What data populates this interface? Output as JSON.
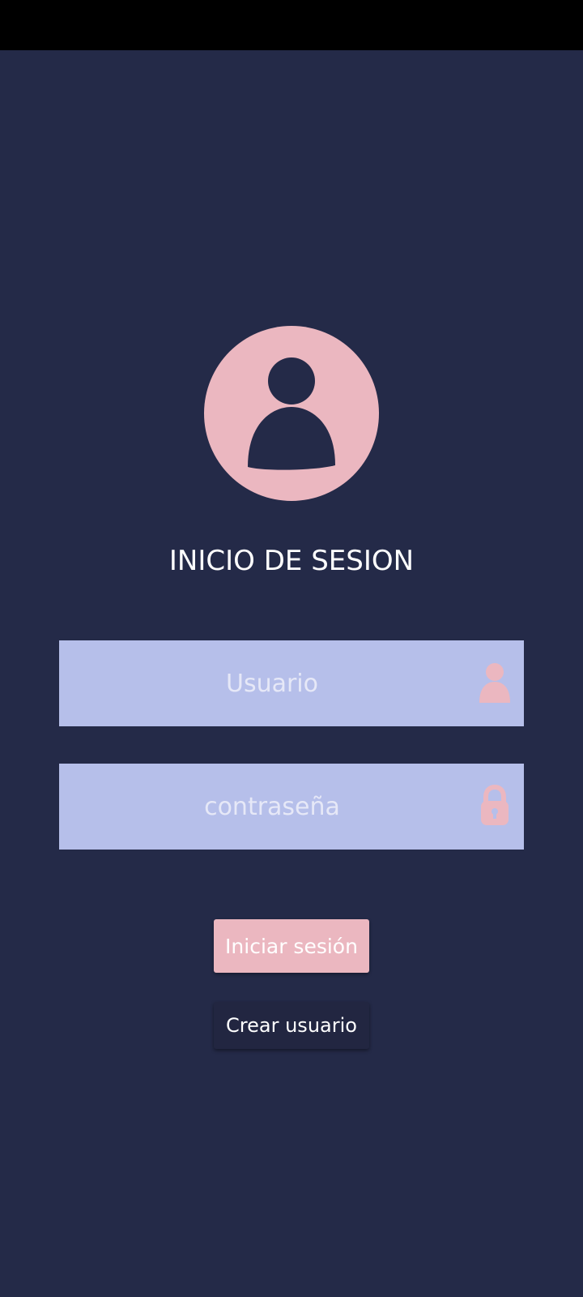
{
  "title": "INICIO DE SESION",
  "form": {
    "username_placeholder": "Usuario",
    "username_value": "",
    "password_placeholder": "contraseña",
    "password_value": ""
  },
  "buttons": {
    "login_label": "Iniciar sesión",
    "create_user_label": "Crear usuario"
  },
  "icons": {
    "avatar": "user-avatar-icon",
    "username": "person-icon",
    "password": "lock-icon"
  },
  "colors": {
    "background": "#242a48",
    "accent_pink": "#ebb7c0",
    "field_bg": "#b6bfea",
    "status_bar": "#000000"
  }
}
